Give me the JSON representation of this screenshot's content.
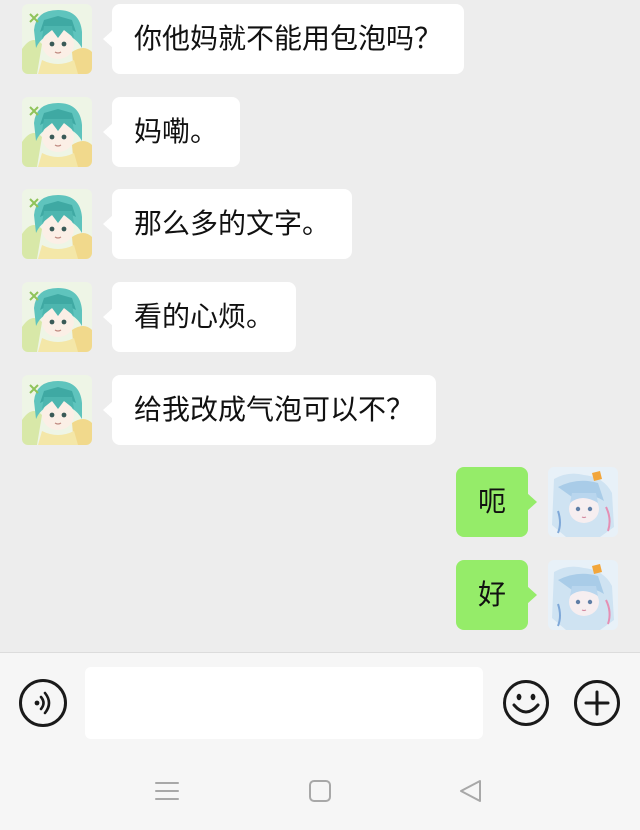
{
  "conversation": {
    "messages": [
      {
        "side": "in",
        "text": "你他妈就不能用包泡吗？"
      },
      {
        "side": "in",
        "text": "妈嘞。"
      },
      {
        "side": "in",
        "text": "那么多的文字。"
      },
      {
        "side": "in",
        "text": "看的心烦。"
      },
      {
        "side": "in",
        "text": "给我改成气泡可以不？"
      },
      {
        "side": "out",
        "text": "呃"
      },
      {
        "side": "out",
        "text": "好"
      }
    ]
  },
  "input": {
    "placeholder": "",
    "value": ""
  },
  "icons": {
    "voice": "voice-icon",
    "emoji": "emoji-icon",
    "plus": "plus-icon",
    "nav_menu": "menu-icon",
    "nav_home": "home-icon",
    "nav_back": "back-icon"
  },
  "colors": {
    "background": "#ededed",
    "incoming_bubble": "#ffffff",
    "outgoing_bubble": "#95ec69",
    "bar": "#f6f6f6"
  }
}
